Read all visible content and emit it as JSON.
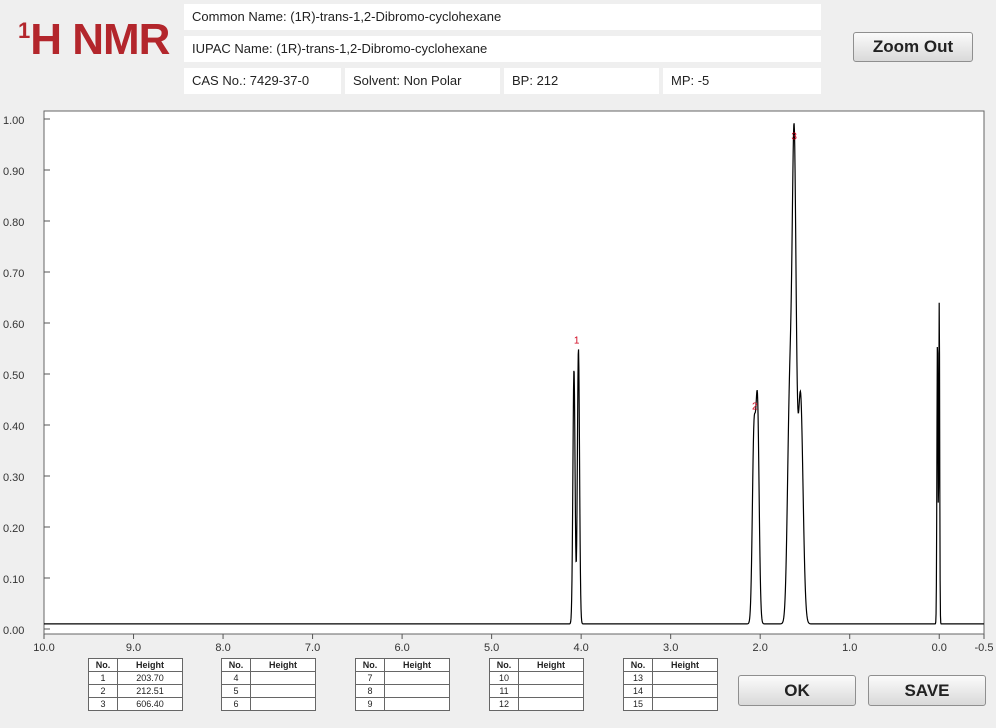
{
  "header": {
    "logo_sup": "1",
    "logo_text": "H NMR",
    "common_name": "Common Name:   (1R)-trans-1,2-Dibromo-cyclohexane",
    "iupac_name": "IUPAC Name:   (1R)-trans-1,2-Dibromo-cyclohexane",
    "cas": "CAS No.: 7429-37-0",
    "solvent": "Solvent: Non Polar",
    "bp": "BP: 212",
    "mp": "MP: -5"
  },
  "buttons": {
    "zoom_out": "Zoom Out",
    "ok": "OK",
    "save": "SAVE"
  },
  "peak_tables": [
    {
      "headers": [
        "No.",
        "Height"
      ],
      "rows": [
        [
          "1",
          "203.70"
        ],
        [
          "2",
          "212.51"
        ],
        [
          "3",
          "606.40"
        ]
      ]
    },
    {
      "headers": [
        "No.",
        "Height"
      ],
      "rows": [
        [
          "4",
          ""
        ],
        [
          "5",
          ""
        ],
        [
          "6",
          ""
        ]
      ]
    },
    {
      "headers": [
        "No.",
        "Height"
      ],
      "rows": [
        [
          "7",
          ""
        ],
        [
          "8",
          ""
        ],
        [
          "9",
          ""
        ]
      ]
    },
    {
      "headers": [
        "No.",
        "Height"
      ],
      "rows": [
        [
          "10",
          ""
        ],
        [
          "11",
          ""
        ],
        [
          "12",
          ""
        ]
      ]
    },
    {
      "headers": [
        "No.",
        "Height"
      ],
      "rows": [
        [
          "13",
          ""
        ],
        [
          "14",
          ""
        ],
        [
          "15",
          ""
        ]
      ]
    }
  ],
  "colors": {
    "brand": "#b3262c",
    "peak_label": "#d0021b",
    "trace": "#000000"
  },
  "chart_data": {
    "type": "line",
    "xlim": [
      10.0,
      -0.5
    ],
    "ylim": [
      0.0,
      1.0
    ],
    "x_reversed": true,
    "grid": false,
    "x_ticks": [
      10.0,
      9.0,
      8.0,
      7.0,
      6.0,
      5.0,
      4.0,
      3.0,
      2.0,
      1.0,
      0.0,
      -0.5
    ],
    "x_tick_labels": [
      "10.0",
      "9.0",
      "8.0",
      "7.0",
      "6.0",
      "5.0",
      "4.0",
      "3.0",
      "2.0",
      "1.0",
      "0.0",
      "-0.5"
    ],
    "y_ticks": [
      0.0,
      0.1,
      0.2,
      0.3,
      0.4,
      0.5,
      0.6,
      0.7,
      0.8,
      0.9,
      1.0
    ],
    "y_tick_labels": [
      "0.00",
      "0.10",
      "0.20",
      "0.30",
      "0.40",
      "0.50",
      "0.60",
      "0.70",
      "0.80",
      "0.90",
      "1.00"
    ],
    "baseline": 0.01,
    "spectrum": [
      {
        "center": 4.08,
        "height": 0.5,
        "width": 0.012
      },
      {
        "center": 4.03,
        "height": 0.54,
        "width": 0.012
      },
      {
        "center": 2.07,
        "height": 0.36,
        "width": 0.018
      },
      {
        "center": 2.03,
        "height": 0.42,
        "width": 0.018
      },
      {
        "center": 1.67,
        "height": 0.44,
        "width": 0.025
      },
      {
        "center": 1.62,
        "height": 0.9,
        "width": 0.022
      },
      {
        "center": 1.55,
        "height": 0.45,
        "width": 0.028
      },
      {
        "center": 0.02,
        "height": 0.56,
        "width": 0.006
      },
      {
        "center": 0.0,
        "height": 0.63,
        "width": 0.005
      }
    ],
    "peak_labels": [
      {
        "label": "1",
        "x": 4.05,
        "y": 0.56
      },
      {
        "label": "2",
        "x": 2.06,
        "y": 0.43
      },
      {
        "label": "3",
        "x": 1.62,
        "y": 0.96
      }
    ]
  }
}
